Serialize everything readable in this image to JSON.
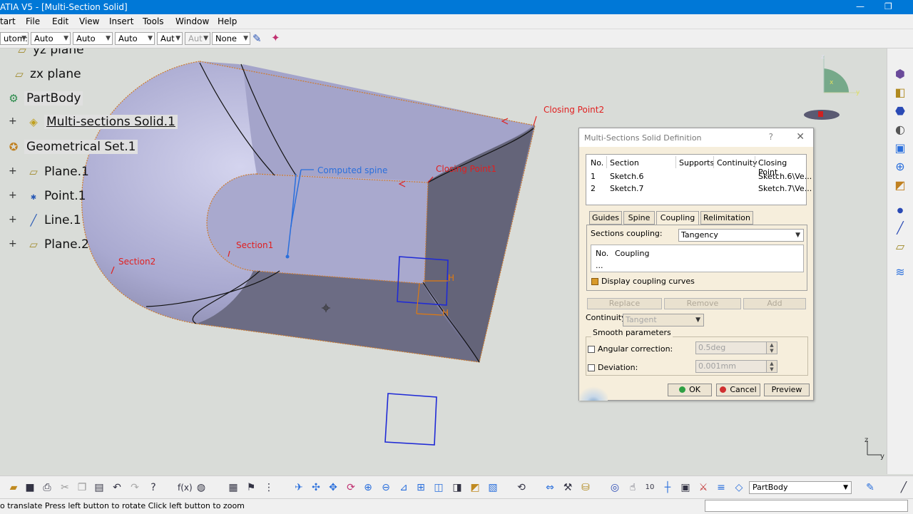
{
  "window": {
    "title": "ATIA V5 - [Multi-Section Solid]",
    "minimize": "—",
    "restore": "❐"
  },
  "menu": [
    "tart",
    "File",
    "Edit",
    "View",
    "Insert",
    "Tools",
    "Window",
    "Help"
  ],
  "properties_toolbar": {
    "combos": [
      {
        "value": "utom:",
        "disabled": false
      },
      {
        "value": "Auto",
        "disabled": false
      },
      {
        "value": "Auto",
        "disabled": false
      },
      {
        "value": "Auto",
        "disabled": false
      },
      {
        "value": "Aut",
        "disabled": false
      },
      {
        "value": "Aut",
        "disabled": true
      },
      {
        "value": "None",
        "disabled": false
      }
    ]
  },
  "tree": {
    "items": [
      {
        "label": "yz plane",
        "icon": "plane-icon"
      },
      {
        "label": "zx plane",
        "icon": "plane-icon"
      },
      {
        "label": "PartBody",
        "icon": "partbody-icon"
      },
      {
        "label": "Multi-sections Solid.1",
        "icon": "multisection-solid-icon"
      },
      {
        "label": "Geometrical Set.1",
        "icon": "geometrical-set-icon"
      },
      {
        "label": "Plane.1",
        "icon": "plane-icon"
      },
      {
        "label": "Point.1",
        "icon": "point-icon"
      },
      {
        "label": "Line.1",
        "icon": "line-icon"
      },
      {
        "label": "Plane.2",
        "icon": "plane-icon"
      }
    ]
  },
  "viewport_labels": {
    "closing_point2": "Closing Point2",
    "closing_point1": "Closing Point1",
    "computed_spine": "Computed spine",
    "section1": "Section1",
    "section2": "Section2",
    "handle_h1": "H",
    "handle_h2": "H"
  },
  "compass": {
    "x": "x",
    "y": "y",
    "z": "z"
  },
  "axis_triad": {
    "z": "z",
    "y": "y"
  },
  "dialog": {
    "title": "Multi-Sections Solid Definition",
    "help": "?",
    "close": "✕",
    "table": {
      "headers": [
        "No.",
        "Section",
        "Supports",
        "Continuity",
        "Closing Point"
      ],
      "rows": [
        [
          "1",
          "Sketch.6",
          "",
          "",
          "Sketch.6\\Ve..."
        ],
        [
          "2",
          "Sketch.7",
          "",
          "",
          "Sketch.7\\Ve..."
        ]
      ]
    },
    "tabs": [
      {
        "label": "Guides",
        "active": false
      },
      {
        "label": "Spine",
        "active": false
      },
      {
        "label": "Coupling",
        "active": true
      },
      {
        "label": "Relimitation",
        "active": false
      }
    ],
    "coupling": {
      "label": "Sections coupling:",
      "value": "Tangency",
      "list_headers": [
        "No.",
        "Coupling"
      ],
      "list_rows": [
        "..."
      ],
      "display_curves_label": "Display coupling curves",
      "display_curves_checked": true
    },
    "buttons": {
      "replace": "Replace",
      "remove": "Remove",
      "add": "Add"
    },
    "continuity": {
      "label": "Continuity:",
      "value": "Tangent"
    },
    "smooth": {
      "group_label": "Smooth parameters",
      "angular_label": "Angular correction:",
      "angular_value": "0.5deg",
      "angular_checked": false,
      "deviation_label": "Deviation:",
      "deviation_value": "0.001mm",
      "deviation_checked": false
    },
    "footer": {
      "ok": "OK",
      "cancel": "Cancel",
      "preview": "Preview"
    }
  },
  "bottom_toolbar": {
    "layer_value": "PartBody"
  },
  "status": {
    "message": "o translate  Press left button to rotate  Click left button to zoom"
  },
  "colors": {
    "titlebar": "#0078d7",
    "solid_top": "#a9a9d0",
    "solid_side": "#646479",
    "section_blue": "#1f2ad6",
    "label_red": "#e02020",
    "label_blue": "#2a6fdc",
    "dialog_bg": "#f6eedc"
  }
}
